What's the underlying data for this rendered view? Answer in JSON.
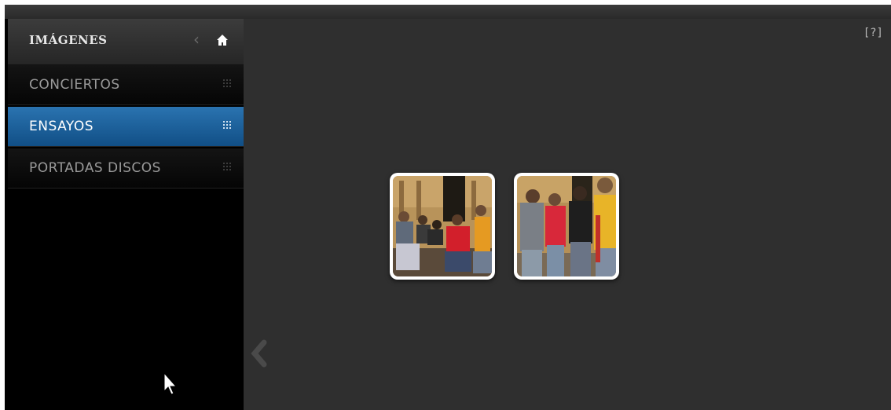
{
  "sidebar": {
    "title": "IMÁGENES",
    "back_icon": "chevron-left-icon",
    "home_icon": "home-icon",
    "items": [
      {
        "label": "CONCIERTOS",
        "active": false,
        "icon": "grid-icon"
      },
      {
        "label": "ENSAYOS",
        "active": true,
        "icon": "grid-icon"
      },
      {
        "label": "PORTADAS DISCOS",
        "active": false,
        "icon": "grid-icon"
      }
    ]
  },
  "main": {
    "help_label": "[?]",
    "thumbnails": [
      {
        "name": "rehearsal-photo-1"
      },
      {
        "name": "rehearsal-photo-2"
      }
    ]
  },
  "colors": {
    "active_nav": "#1f6aa8",
    "main_bg": "#2f2f2f",
    "sidebar_bg": "#000000"
  }
}
